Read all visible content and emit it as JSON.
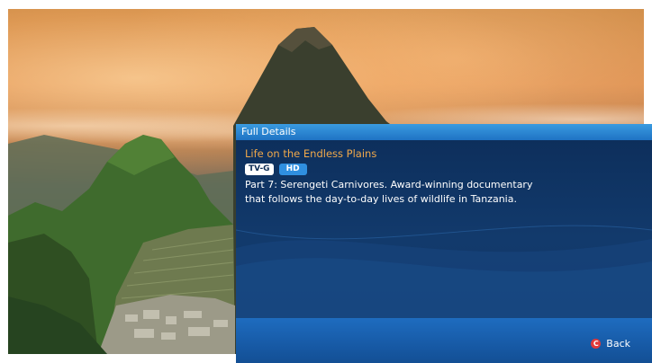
{
  "panel": {
    "header_title": "Full Details",
    "show_title": "Life on the Endless Plains",
    "rating_badge": "TV-G",
    "hd_badge": "HD",
    "description_line1": "Part 7: Serengeti Carnivores. Award-winning documentary",
    "description_line2": "that follows the day-to-day lives of wildlife in Tanzania."
  },
  "footer": {
    "back_icon_glyph": "C",
    "back_label": "Back",
    "back_icon": "red-c-button-icon"
  },
  "colors": {
    "panel_background": "#0e2d55",
    "header_blue": "#2d86d6",
    "title_orange": "#f0a84a",
    "back_icon_red": "#e23a3a"
  }
}
